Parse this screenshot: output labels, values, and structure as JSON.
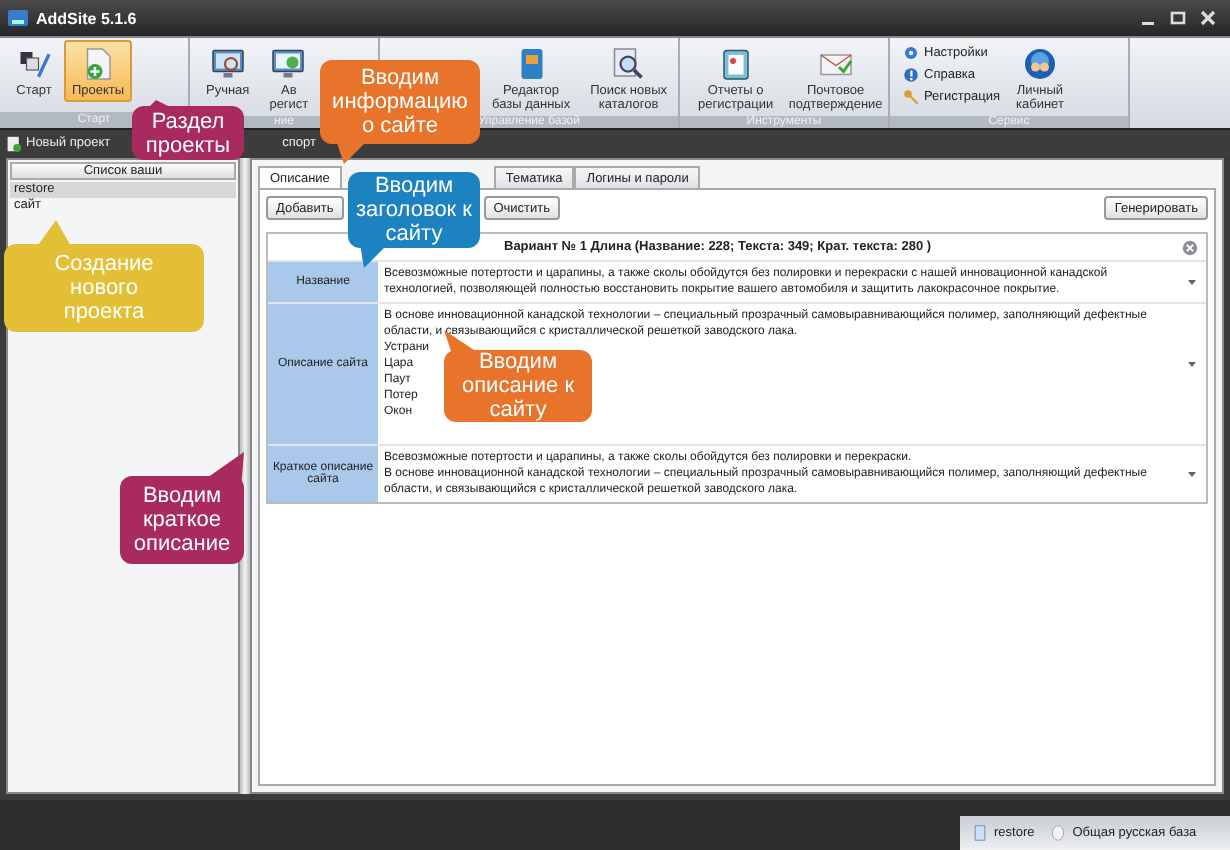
{
  "window": {
    "title": "AddSite 5.1.6"
  },
  "ribbon": [
    {
      "label": "Старт",
      "items": [
        {
          "kind": "large",
          "lines": [
            "Старт"
          ],
          "selected": false
        },
        {
          "kind": "large",
          "lines": [
            "Проекты"
          ],
          "selected": true
        }
      ]
    },
    {
      "label": "ние",
      "items": [
        {
          "kind": "large",
          "lines": [
            "Ручная"
          ],
          "selected": false
        },
        {
          "kind": "large",
          "lines": [
            "Ав",
            "регист"
          ],
          "selected": false
        }
      ]
    },
    {
      "label": "Управление базой",
      "items": [
        {
          "kind": "large",
          "lines": [
            "Редактор",
            "базы данных"
          ],
          "selected": false
        },
        {
          "kind": "large",
          "lines": [
            "Поиск новых",
            "каталогов"
          ],
          "selected": false
        }
      ]
    },
    {
      "label": "Инструменты",
      "items": [
        {
          "kind": "large",
          "lines": [
            "Отчеты о",
            "регистрации"
          ],
          "selected": false
        },
        {
          "kind": "large",
          "lines": [
            "Почтовое",
            "подтверждение"
          ],
          "selected": false
        }
      ]
    },
    {
      "label": "Сервис",
      "items": [
        {
          "kind": "small",
          "lines": [
            "Настройки"
          ],
          "selected": false
        },
        {
          "kind": "small",
          "lines": [
            "Справка"
          ],
          "selected": false
        },
        {
          "kind": "small",
          "lines": [
            "Регистрация"
          ],
          "selected": false
        },
        {
          "kind": "large",
          "lines": [
            "Личный",
            "кабинет"
          ],
          "selected": false
        }
      ]
    }
  ],
  "toolbar": [
    {
      "label": "Новый проект"
    },
    {
      "label": "спорт"
    }
  ],
  "projects": {
    "header": "Список ваши",
    "items": [
      {
        "name": "restore",
        "selected": true
      },
      {
        "name": "сайт",
        "selected": false
      }
    ]
  },
  "tabs": [
    {
      "label": "Описание",
      "selected": true
    },
    {
      "label": "Тематика",
      "selected": false
    },
    {
      "label": "Логины и пароли",
      "selected": false
    }
  ],
  "buttons": {
    "add": "Добавить",
    "clear": "Очистить",
    "generate": "Генерировать"
  },
  "variant": {
    "title": "Вариант № 1 Длина (Название: 228; Текста: 349; Крат. текста: 280 )",
    "rows": [
      {
        "label": "Название",
        "lines": [
          "Всевозможные потертости и царапины, а также сколы обойдутся без полировки и перекраски с нашей инновационной канадской технологией, позволяющей полностью восстановить покрытие вашего автомобиля и защитить лакокрасочное покрытие."
        ]
      },
      {
        "label": "Описание сайта",
        "lines": [
          "В основе инновационной канадской технологии – специальный прозрачный самовыравнивающийся полимер, заполняющий дефектные области, и связывающийся с кристаллической решеткой заводского лака.",
          "Устрани",
          "Цара",
          "Паут",
          "Потер",
          "Окон"
        ]
      },
      {
        "label": "Краткое описание сайта",
        "lines": [
          "Всевозможные потертости и царапины, а также сколы обойдутся без полировки и перекраски.",
          "В основе инновационной канадской технологии – специальный прозрачный самовыравнивающийся полимер, заполняющий дефектные области, и связывающийся с кристаллической решеткой заводского лака."
        ]
      }
    ]
  },
  "status_bar": [
    {
      "label": "restore"
    },
    {
      "label": "Общая русская база"
    }
  ],
  "callouts": [
    {
      "lines": [
        "Раздел",
        "проекты"
      ],
      "color": "#a82a5e"
    },
    {
      "lines": [
        "Вводим",
        "информацию",
        "о сайте"
      ],
      "color": "#e8732a"
    },
    {
      "lines": [
        "Вводим",
        "заголовок к",
        "сайту"
      ],
      "color": "#1c82c0"
    },
    {
      "lines": [
        "Создание",
        "нового",
        "проекта"
      ],
      "color": "#e2bf35"
    },
    {
      "lines": [
        "Вводим",
        "описание к",
        "сайту"
      ],
      "color": "#e8732a"
    },
    {
      "lines": [
        "Вводим",
        "краткое",
        "описание"
      ],
      "color": "#a82a5e"
    }
  ]
}
